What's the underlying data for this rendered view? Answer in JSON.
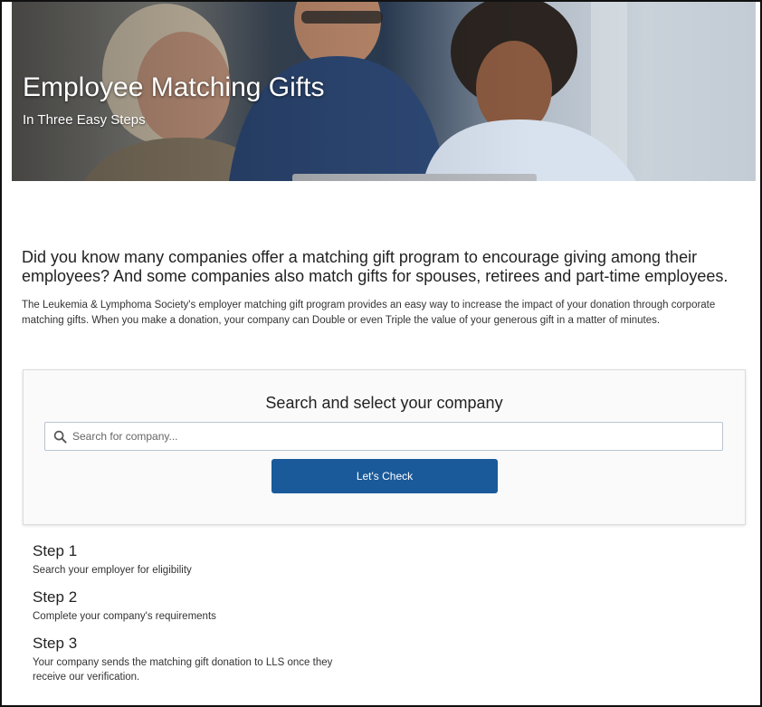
{
  "hero": {
    "title": "Employee Matching Gifts",
    "subtitle": "In Three Easy Steps"
  },
  "intro": {
    "lead": "Did you know many companies offer a matching gift program to encourage giving among their employees? And some companies also match gifts for spouses, retirees and part-time employees.",
    "body": "The Leukemia & Lymphoma Society's employer matching gift program provides an easy way to increase the impact of your donation through corporate matching gifts. When you make a donation, your company can Double or even Triple the value of your generous gift in a matter of minutes."
  },
  "search": {
    "heading": "Search and select your company",
    "placeholder": "Search for company...",
    "value": "",
    "icon": "search-icon",
    "button_label": "Let's Check"
  },
  "steps": [
    {
      "title": "Step 1",
      "description": "Search your employer for eligibility"
    },
    {
      "title": "Step 2",
      "description": "Complete your company's requirements"
    },
    {
      "title": "Step 3",
      "description": "Your company sends the matching gift donation to LLS once they receive our verification."
    }
  ],
  "colors": {
    "button": "#1a5a9a",
    "card_background": "#fafafa",
    "hero_text": "#ffffff"
  }
}
